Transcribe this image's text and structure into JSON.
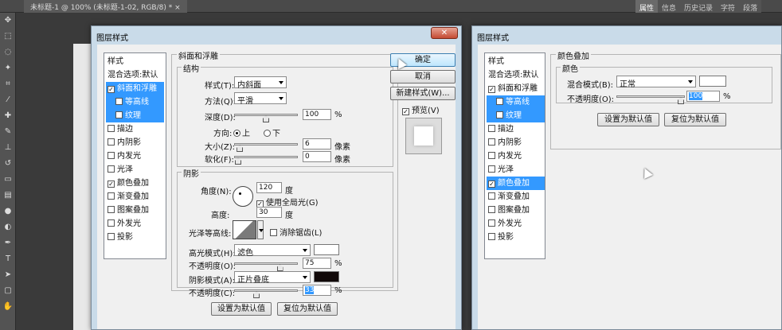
{
  "app": {
    "doc_tab": "未标题-1 @ 100% (未标题-1-02, RGB/8) *",
    "close_x": "×",
    "right_tabs": [
      "属性",
      "信息",
      "历史记录",
      "字符",
      "段落"
    ]
  },
  "left_dialog": {
    "title": "图层样式",
    "close": "✕",
    "styles_header": "样式",
    "styles_items": [
      {
        "label": "混合选项:默认",
        "checkbox": false,
        "checked": false
      },
      {
        "label": "斜面和浮雕",
        "checkbox": true,
        "checked": true,
        "selected": true
      },
      {
        "label": "等高线",
        "checkbox": true,
        "checked": false,
        "sub": true
      },
      {
        "label": "纹理",
        "checkbox": true,
        "checked": false,
        "sub": true
      },
      {
        "label": "描边",
        "checkbox": true,
        "checked": false
      },
      {
        "label": "内阴影",
        "checkbox": true,
        "checked": false
      },
      {
        "label": "内发光",
        "checkbox": true,
        "checked": false
      },
      {
        "label": "光泽",
        "checkbox": true,
        "checked": false
      },
      {
        "label": "颜色叠加",
        "checkbox": true,
        "checked": true
      },
      {
        "label": "渐变叠加",
        "checkbox": true,
        "checked": false
      },
      {
        "label": "图案叠加",
        "checkbox": true,
        "checked": false
      },
      {
        "label": "外发光",
        "checkbox": true,
        "checked": false
      },
      {
        "label": "投影",
        "checkbox": true,
        "checked": false
      }
    ],
    "bevel": {
      "group_title": "斜面和浮雕",
      "structure_title": "结构",
      "style_label": "样式(T):",
      "style_value": "内斜面",
      "technique_label": "方法(Q):",
      "technique_value": "平滑",
      "depth_label": "深度(D):",
      "depth_value": "100",
      "depth_unit": "%",
      "depth_level": 0.5,
      "direction_label": "方向:",
      "dir_up": "上",
      "dir_down": "下",
      "size_label": "大小(Z):",
      "size_value": "6",
      "size_unit": "像素",
      "size_level": 0.03,
      "soften_label": "软化(F):",
      "soften_value": "0",
      "soften_unit": "像素",
      "soften_level": 0.0
    },
    "shading": {
      "title": "阴影",
      "angle_label": "角度(N):",
      "angle_value": "120",
      "angle_unit": "度",
      "global_light_label": "使用全局光(G)",
      "altitude_label": "高度:",
      "altitude_value": "30",
      "altitude_unit": "度",
      "gloss_label": "光泽等高线:",
      "antialias_label": "消除锯齿(L)",
      "highlight_mode_label": "高光模式(H):",
      "highlight_mode_value": "滤色",
      "highlight_color": "#ffffff",
      "highlight_opacity_label": "不透明度(O):",
      "highlight_opacity_value": "75",
      "highlight_opacity_unit": "%",
      "highlight_opacity_level": 0.75,
      "shadow_mode_label": "阴影模式(A):",
      "shadow_mode_value": "正片叠底",
      "shadow_color": "#100808",
      "shadow_opacity_label": "不透明度(C):",
      "shadow_opacity_value": "33",
      "shadow_opacity_unit": "%",
      "shadow_opacity_level": 0.33
    },
    "set_default": "设置为默认值",
    "reset_default": "复位为默认值",
    "ok": "确定",
    "cancel": "取消",
    "new_style": "新建样式(W)...",
    "preview_label": "预览(V)"
  },
  "right_dialog": {
    "title": "图层样式",
    "styles_header": "样式",
    "styles_items": [
      {
        "label": "混合选项:默认",
        "checkbox": false,
        "checked": false
      },
      {
        "label": "斜面和浮雕",
        "checkbox": true,
        "checked": true
      },
      {
        "label": "等高线",
        "checkbox": true,
        "checked": false,
        "sub": true
      },
      {
        "label": "纹理",
        "checkbox": true,
        "checked": false,
        "sub": true
      },
      {
        "label": "描边",
        "checkbox": true,
        "checked": false
      },
      {
        "label": "内阴影",
        "checkbox": true,
        "checked": false
      },
      {
        "label": "内发光",
        "checkbox": true,
        "checked": false
      },
      {
        "label": "光泽",
        "checkbox": true,
        "checked": false
      },
      {
        "label": "颜色叠加",
        "checkbox": true,
        "checked": true,
        "selected": true
      },
      {
        "label": "渐变叠加",
        "checkbox": true,
        "checked": false
      },
      {
        "label": "图案叠加",
        "checkbox": true,
        "checked": false
      },
      {
        "label": "外发光",
        "checkbox": true,
        "checked": false
      },
      {
        "label": "投影",
        "checkbox": true,
        "checked": false
      }
    ],
    "overlay": {
      "group_title": "颜色叠加",
      "color_title": "颜色",
      "blend_label": "混合模式(B):",
      "blend_value": "正常",
      "color": "#ffffff",
      "opacity_label": "不透明度(O):",
      "opacity_value": "100",
      "opacity_unit": "%",
      "opacity_level": 1.0
    },
    "set_default": "设置为默认值",
    "reset_default": "复位为默认值"
  }
}
